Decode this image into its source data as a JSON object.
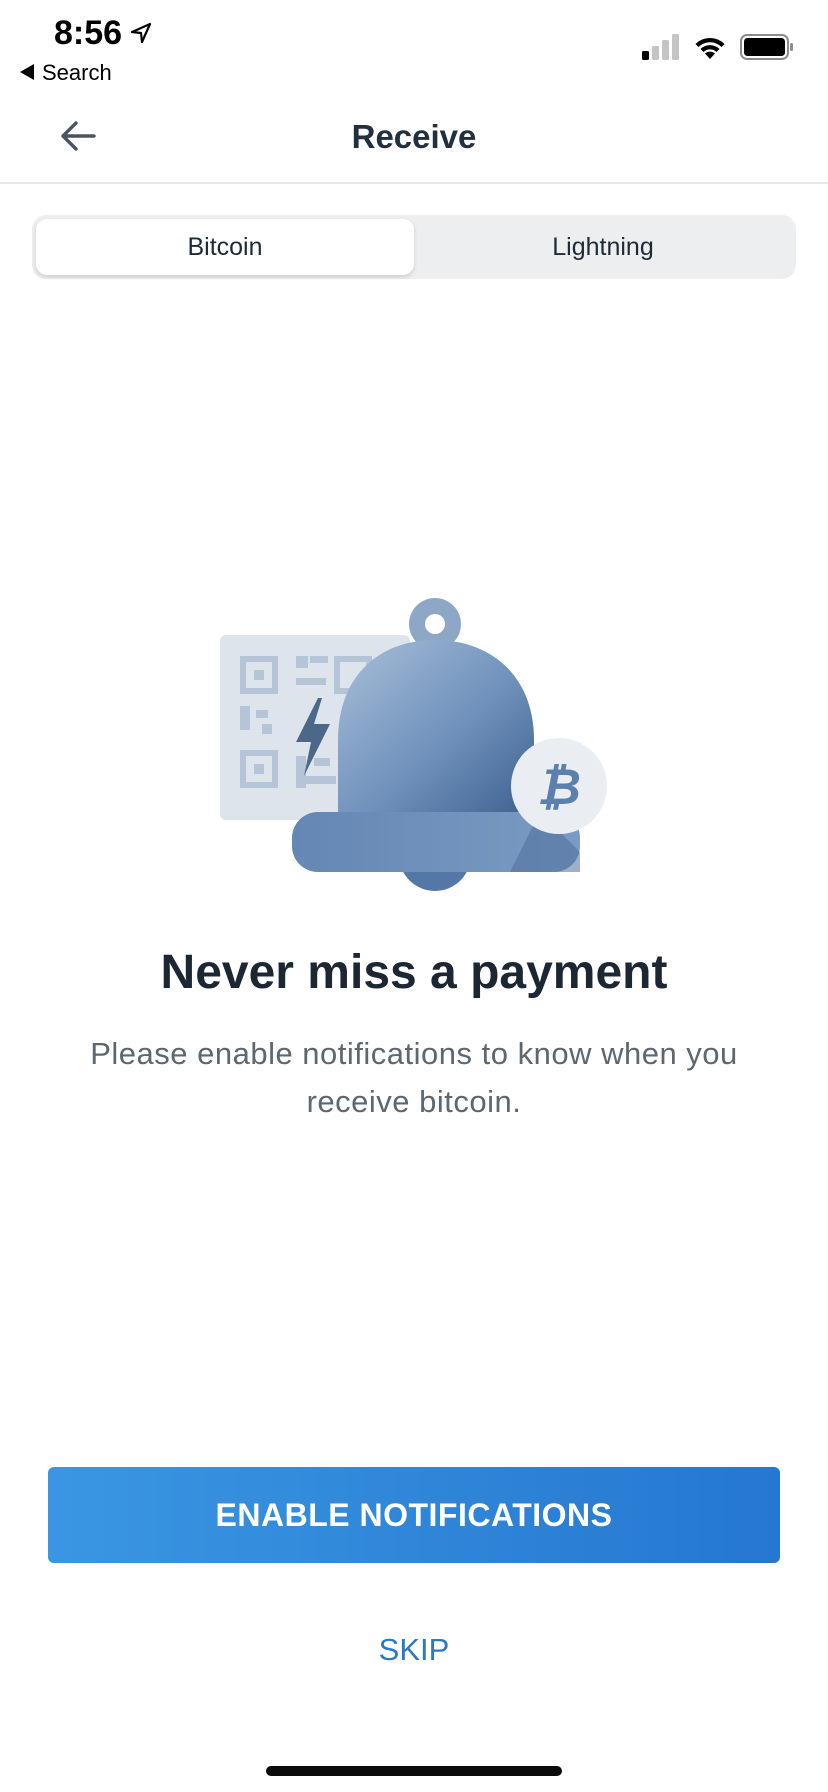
{
  "status_bar": {
    "time": "8:56",
    "back_app": "Search"
  },
  "navbar": {
    "title": "Receive"
  },
  "segments": [
    {
      "label": "Bitcoin",
      "active": true
    },
    {
      "label": "Lightning",
      "active": false
    }
  ],
  "content": {
    "headline": "Never miss a payment",
    "description": "Please enable notifications to know when you receive bitcoin."
  },
  "actions": {
    "enable_label": "ENABLE NOTIFICATIONS",
    "skip_label": "SKIP"
  },
  "icons": {
    "back": "arrow-left-icon",
    "location": "location-arrow-icon",
    "signal": "cellular-signal-icon",
    "wifi": "wifi-icon",
    "battery": "battery-icon",
    "bell": "bell-icon",
    "bitcoin": "bitcoin-icon",
    "lightning": "lightning-icon",
    "qr": "qr-code-icon"
  },
  "colors": {
    "accent": "#2b7ad3",
    "bell": "#6a8cb6",
    "text_primary": "#1c2733",
    "text_secondary": "#5d6770"
  }
}
